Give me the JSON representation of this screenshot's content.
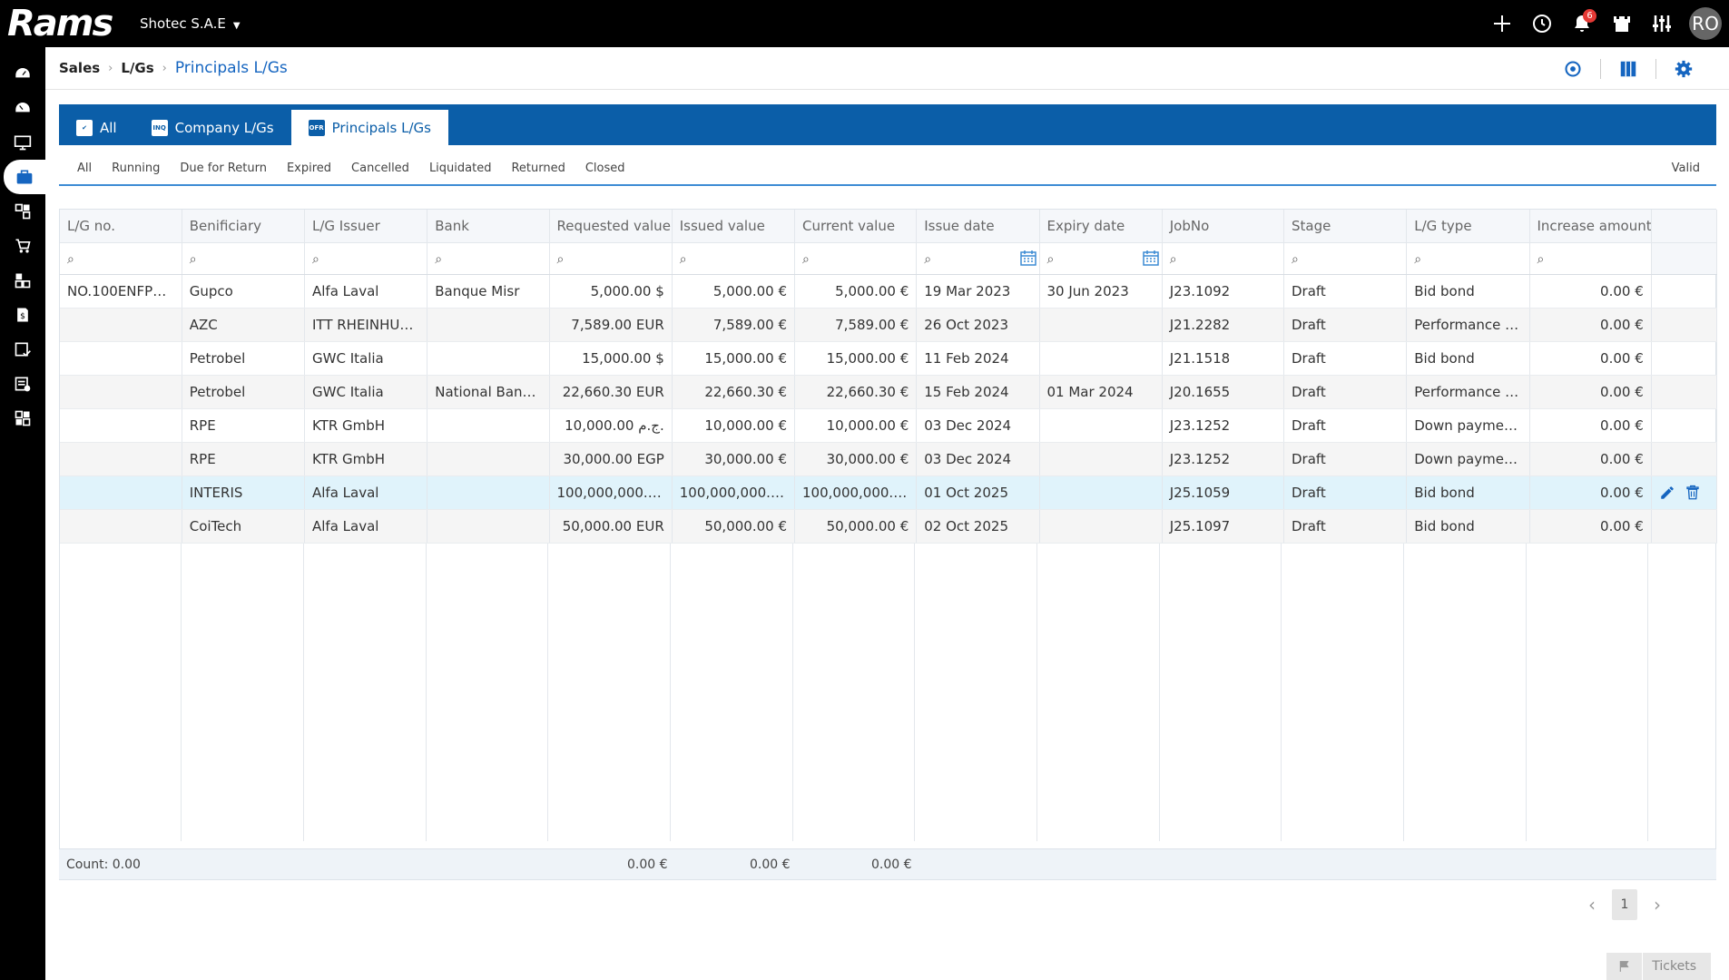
{
  "app": {
    "logo_text": "Rams",
    "company": "Shotec S.A.E",
    "notifications_count": "6",
    "user_initials": "RO"
  },
  "breadcrumb": [
    "Sales",
    "L/Gs",
    "Principals L/Gs"
  ],
  "tabs": [
    {
      "label": "All",
      "icon": "check-box-icon"
    },
    {
      "label": "Company L/Gs",
      "icon": "inq-icon",
      "badge": "INQ"
    },
    {
      "label": "Principals L/Gs",
      "icon": "offer-icon",
      "badge": "OFR",
      "active": true
    }
  ],
  "filters": [
    "All",
    "Running",
    "Due for Return",
    "Expired",
    "Cancelled",
    "Liquidated",
    "Returned",
    "Closed"
  ],
  "filter_right": "Valid",
  "columns": [
    "L/G no.",
    "Benificiary",
    "L/G Issuer",
    "Bank",
    "Requested value",
    "Issued value",
    "Current value",
    "Issue date",
    "Expiry date",
    "JobNo",
    "Stage",
    "L/G type",
    "Increase amount"
  ],
  "rows": [
    {
      "lg_no": "NO.100ENFP230...",
      "beneficiary": "Gupco",
      "issuer": "Alfa Laval",
      "bank": "Banque Misr",
      "requested": "5,000.00 $",
      "issued": "5,000.00 €",
      "current": "5,000.00 €",
      "issue_date": "19 Mar 2023",
      "expiry_date": "30 Jun 2023",
      "job_no": "J23.1092",
      "stage": "Draft",
      "lg_type": "Bid bond",
      "increase": "0.00 €"
    },
    {
      "lg_no": "",
      "beneficiary": "AZC",
      "issuer": "ITT RHEINHUTTE",
      "bank": "",
      "requested": "7,589.00 EUR",
      "issued": "7,589.00 €",
      "current": "7,589.00 €",
      "issue_date": "26 Oct 2023",
      "expiry_date": "",
      "job_no": "J21.2282",
      "stage": "Draft",
      "lg_type": "Performance bo...",
      "increase": "0.00 €"
    },
    {
      "lg_no": "",
      "beneficiary": "Petrobel",
      "issuer": "GWC Italia",
      "bank": "",
      "requested": "15,000.00 $",
      "issued": "15,000.00 €",
      "current": "15,000.00 €",
      "issue_date": "11 Feb 2024",
      "expiry_date": "",
      "job_no": "J21.1518",
      "stage": "Draft",
      "lg_type": "Bid bond",
      "increase": "0.00 €"
    },
    {
      "lg_no": "",
      "beneficiary": "Petrobel",
      "issuer": "GWC Italia",
      "bank": "National Bank O...",
      "requested": "22,660.30 EUR",
      "issued": "22,660.30 €",
      "current": "22,660.30 €",
      "issue_date": "15 Feb 2024",
      "expiry_date": "01 Mar 2024",
      "job_no": "J20.1655",
      "stage": "Draft",
      "lg_type": "Performance bo...",
      "increase": "0.00 €"
    },
    {
      "lg_no": "",
      "beneficiary": "RPE",
      "issuer": "KTR GmbH",
      "bank": "",
      "requested": "10,000.00 ج.م.",
      "issued": "10,000.00 €",
      "current": "10,000.00 €",
      "issue_date": "03 Dec 2024",
      "expiry_date": "",
      "job_no": "J23.1252",
      "stage": "Draft",
      "lg_type": "Down payment ...",
      "increase": "0.00 €"
    },
    {
      "lg_no": "",
      "beneficiary": "RPE",
      "issuer": "KTR GmbH",
      "bank": "",
      "requested": "30,000.00 EGP",
      "issued": "30,000.00 €",
      "current": "30,000.00 €",
      "issue_date": "03 Dec 2024",
      "expiry_date": "",
      "job_no": "J23.1252",
      "stage": "Draft",
      "lg_type": "Down payment ...",
      "increase": "0.00 €"
    },
    {
      "lg_no": "",
      "beneficiary": "INTERIS",
      "issuer": "Alfa Laval",
      "bank": "",
      "requested": "100,000,000.00 ...",
      "issued": "100,000,000.00 €",
      "current": "100,000,000.00 €",
      "issue_date": "01 Oct 2025",
      "expiry_date": "",
      "job_no": "J25.1059",
      "stage": "Draft",
      "lg_type": "Bid bond",
      "increase": "0.00 €"
    },
    {
      "lg_no": "",
      "beneficiary": "CoiTech",
      "issuer": "Alfa Laval",
      "bank": "",
      "requested": "50,000.00 EUR",
      "issued": "50,000.00 €",
      "current": "50,000.00 €",
      "issue_date": "02 Oct 2025",
      "expiry_date": "",
      "job_no": "J25.1097",
      "stage": "Draft",
      "lg_type": "Bid bond",
      "increase": "0.00 €"
    }
  ],
  "footer": {
    "count": "Count: 0.00",
    "issued_total": "0.00 €",
    "current_total": "0.00 €",
    "increase_total": "0.00 €"
  },
  "pager": {
    "page": "1"
  },
  "tickets_label": "Tickets",
  "colors": {
    "brand_blue": "#0b5ea8",
    "selected_row": "#e0f3fb",
    "topbar": "#000000"
  }
}
